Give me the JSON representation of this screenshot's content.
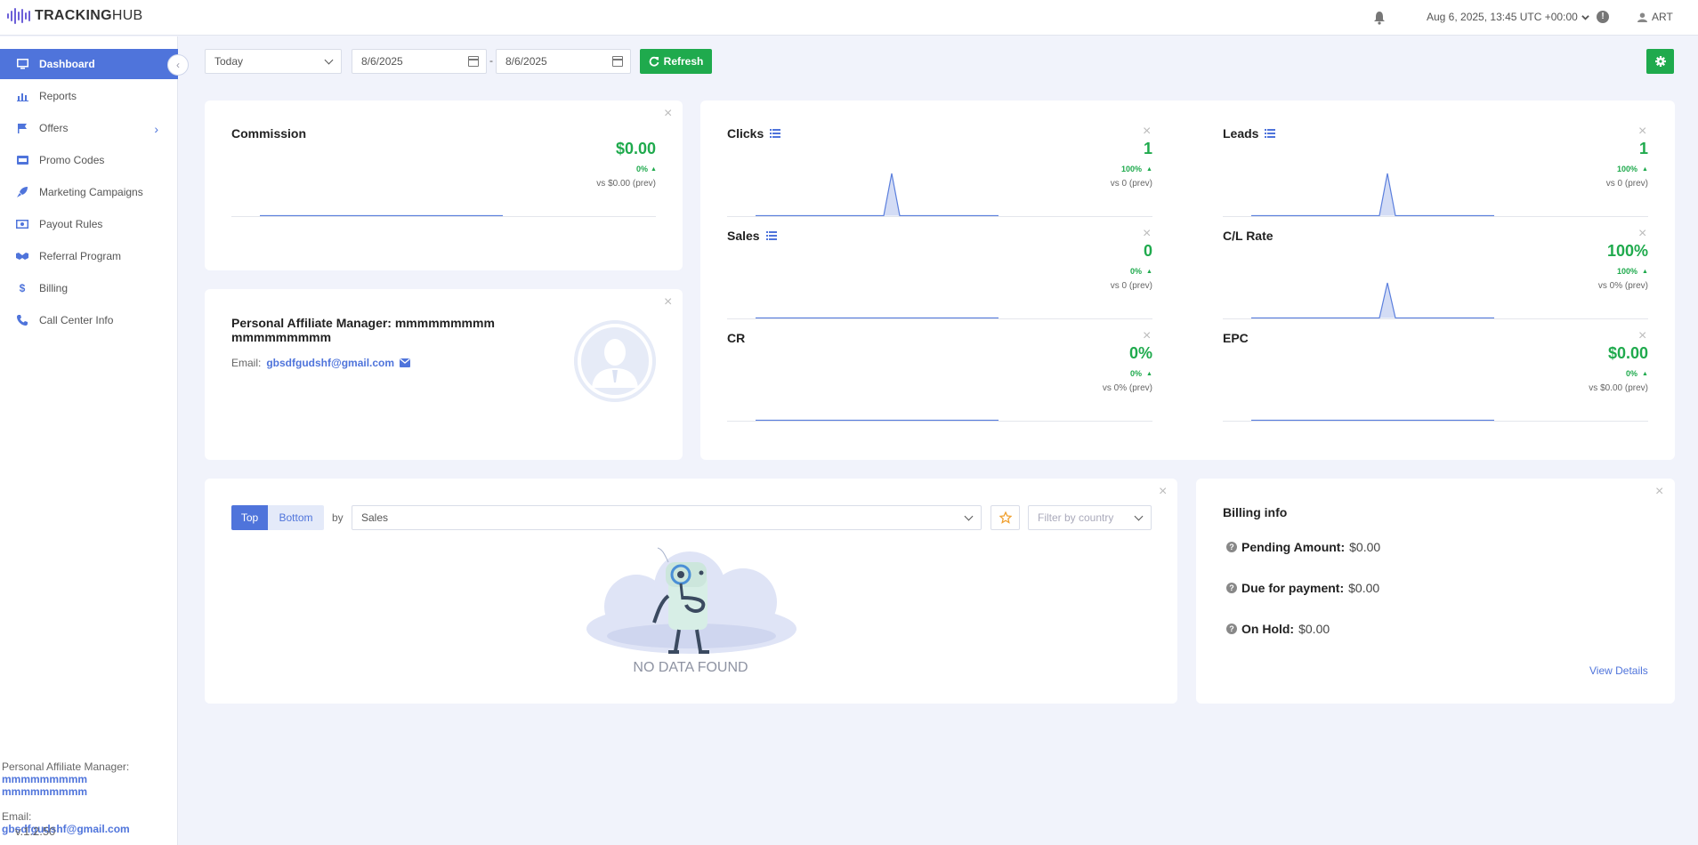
{
  "header": {
    "logo_text_bold": "TRACKING",
    "logo_text_rest": "HUB",
    "datetime": "Aug 6, 2025, 13:45 UTC +00:00",
    "user": "ART",
    "icons": [
      "bell-icon",
      "chevron-down-icon",
      "info-icon",
      "user-icon"
    ]
  },
  "sidebar": {
    "items": [
      {
        "label": "Dashboard",
        "icon": "monitor-icon"
      },
      {
        "label": "Reports",
        "icon": "bar-chart-icon"
      },
      {
        "label": "Offers",
        "icon": "flag-icon"
      },
      {
        "label": "Promo Codes",
        "icon": "ticket-icon"
      },
      {
        "label": "Marketing Campaigns",
        "icon": "rocket-icon"
      },
      {
        "label": "Payout Rules",
        "icon": "money-icon"
      },
      {
        "label": "Referral Program",
        "icon": "handshake-icon"
      },
      {
        "label": "Billing",
        "icon": "dollar-icon"
      },
      {
        "label": "Call Center Info",
        "icon": "phone-icon"
      }
    ],
    "collapse_glyph": "‹",
    "footer": {
      "manager_label": "Personal Affiliate Manager:",
      "manager_name_1": "mmmmmmmmm",
      "manager_name_2": "mmmmmmmmm",
      "email_label": "Email:",
      "email": "gbsdfgudshf@gmail.com"
    },
    "version": "v.1.2.50"
  },
  "toolbar": {
    "period": "Today",
    "date_from": "8/6/2025",
    "separator": "-",
    "date_to": "8/6/2025",
    "refresh_label": "Refresh",
    "accent": "#1faa4d"
  },
  "commission": {
    "title": "Commission",
    "value": "$0.00",
    "pct": "0%",
    "prev": "vs $0.00 (prev)"
  },
  "manager_card": {
    "title": "Personal Affiliate Manager: mmmmmmmmm mmmmmmmmm",
    "email_label": "Email:",
    "email": "gbsdfgudshf@gmail.com"
  },
  "metrics": {
    "clicks": {
      "title": "Clicks",
      "value": "1",
      "pct": "100%",
      "prev": "vs 0 (prev)"
    },
    "leads": {
      "title": "Leads",
      "value": "1",
      "pct": "100%",
      "prev": "vs 0 (prev)"
    },
    "sales": {
      "title": "Sales",
      "value": "0",
      "pct": "0%",
      "prev": "vs 0 (prev)"
    },
    "cl_rate": {
      "title": "C/L Rate",
      "value": "100%",
      "pct": "100%",
      "prev": "vs 0% (prev)"
    },
    "cr": {
      "title": "CR",
      "value": "0%",
      "pct": "0%",
      "prev": "vs 0% (prev)"
    },
    "epc": {
      "title": "EPC",
      "value": "$0.00",
      "pct": "0%",
      "prev": "vs $0.00 (prev)"
    }
  },
  "top_panel": {
    "tab_top": "Top",
    "tab_bottom": "Bottom",
    "by_label": "by",
    "metric_select": "Sales",
    "country_placeholder": "Filter by country",
    "no_data": "NO DATA FOUND"
  },
  "billing": {
    "title": "Billing info",
    "pending_label": "Pending Amount:",
    "pending_value": "$0.00",
    "due_label": "Due for payment:",
    "due_value": "$0.00",
    "hold_label": "On Hold:",
    "hold_value": "$0.00",
    "view_details": "View Details"
  },
  "colors": {
    "primary": "#4f74db",
    "success": "#1faa4d",
    "background": "#f1f3fb"
  }
}
